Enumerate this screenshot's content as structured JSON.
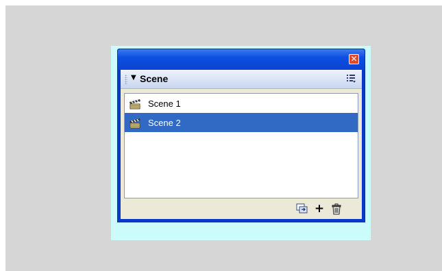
{
  "window": {
    "close_icon": "close-icon",
    "close_glyph": "✕"
  },
  "panel": {
    "title": "Scene",
    "collapse_glyph": "▼",
    "options_icon": "panel-options-icon"
  },
  "scenes": [
    {
      "label": "Scene 1",
      "selected": false,
      "icon": "clapperboard-icon"
    },
    {
      "label": "Scene 2",
      "selected": true,
      "icon": "clapperboard-icon"
    }
  ],
  "footer": {
    "duplicate_icon": "duplicate-scene-icon",
    "add_glyph": "+",
    "add_icon": "add-scene-icon",
    "delete_icon": "trash-icon"
  },
  "colors": {
    "titlebar": "#0c4fe0",
    "selection": "#316ac5",
    "close": "#e04a2a",
    "backdrop": "#ccfbfb"
  }
}
